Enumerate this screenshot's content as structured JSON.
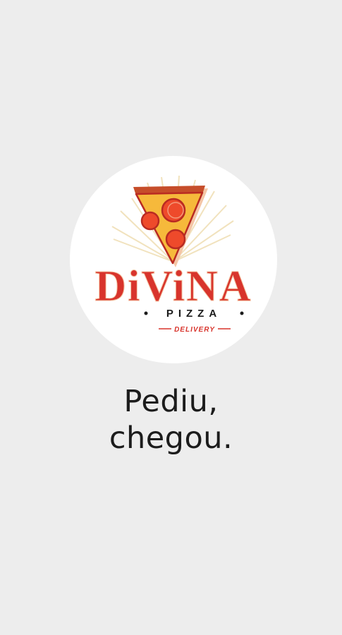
{
  "splash": {
    "logo": {
      "brand_name": "DiViNA",
      "sub_name": "PIZZA",
      "service": "DELIVERY",
      "colors": {
        "red": "#d8342c",
        "dark_red": "#b92b22",
        "crust": "#c64d2a",
        "cheese": "#f6b93b",
        "pepperoni": "#ee4a2b",
        "shadow": "#f4c6a6",
        "rays": "#f1e2bd",
        "circle": "#ffffff"
      }
    },
    "tagline_line1": "Pediu,",
    "tagline_line2": "chegou."
  },
  "colors": {
    "background": "#ededed",
    "text": "#1c1c1c"
  }
}
